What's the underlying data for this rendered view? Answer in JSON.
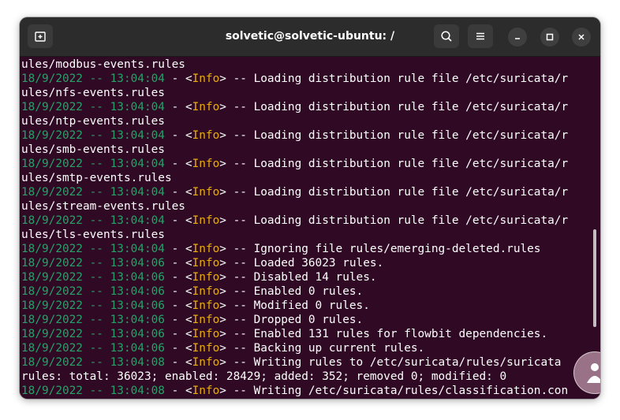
{
  "window": {
    "title": "solvetic@solvetic-ubuntu: /"
  },
  "icons": {
    "new_tab": "new-tab-icon",
    "search": "search-icon",
    "menu": "hamburger-menu-icon",
    "minimize": "minimize-icon",
    "maximize": "maximize-icon",
    "close": "close-icon",
    "watermark": "solvetic-logo"
  },
  "colors": {
    "terminal_bg": "#300a24",
    "titlebar_bg": "#2c2c2c",
    "date_text": "#26a269",
    "info_text": "#e9ad0c",
    "plain_text": "#ffffff"
  },
  "terminal": {
    "lines": [
      {
        "plain": "ules/modbus-events.rules"
      },
      {
        "date": "18/9/2022 -- 13:04:04",
        "pre": " - <",
        "level": "Info",
        "msg": "> -- Loading distribution rule file /etc/suricata/r"
      },
      {
        "plain": "ules/nfs-events.rules"
      },
      {
        "date": "18/9/2022 -- 13:04:04",
        "pre": " - <",
        "level": "Info",
        "msg": "> -- Loading distribution rule file /etc/suricata/r"
      },
      {
        "plain": "ules/ntp-events.rules"
      },
      {
        "date": "18/9/2022 -- 13:04:04",
        "pre": " - <",
        "level": "Info",
        "msg": "> -- Loading distribution rule file /etc/suricata/r"
      },
      {
        "plain": "ules/smb-events.rules"
      },
      {
        "date": "18/9/2022 -- 13:04:04",
        "pre": " - <",
        "level": "Info",
        "msg": "> -- Loading distribution rule file /etc/suricata/r"
      },
      {
        "plain": "ules/smtp-events.rules"
      },
      {
        "date": "18/9/2022 -- 13:04:04",
        "pre": " - <",
        "level": "Info",
        "msg": "> -- Loading distribution rule file /etc/suricata/r"
      },
      {
        "plain": "ules/stream-events.rules"
      },
      {
        "date": "18/9/2022 -- 13:04:04",
        "pre": " - <",
        "level": "Info",
        "msg": "> -- Loading distribution rule file /etc/suricata/r"
      },
      {
        "plain": "ules/tls-events.rules"
      },
      {
        "date": "18/9/2022 -- 13:04:04",
        "pre": " - <",
        "level": "Info",
        "msg": "> -- Ignoring file rules/emerging-deleted.rules"
      },
      {
        "date": "18/9/2022 -- 13:04:06",
        "pre": " - <",
        "level": "Info",
        "msg": "> -- Loaded 36023 rules."
      },
      {
        "date": "18/9/2022 -- 13:04:06",
        "pre": " - <",
        "level": "Info",
        "msg": "> -- Disabled 14 rules."
      },
      {
        "date": "18/9/2022 -- 13:04:06",
        "pre": " - <",
        "level": "Info",
        "msg": "> -- Enabled 0 rules."
      },
      {
        "date": "18/9/2022 -- 13:04:06",
        "pre": " - <",
        "level": "Info",
        "msg": "> -- Modified 0 rules."
      },
      {
        "date": "18/9/2022 -- 13:04:06",
        "pre": " - <",
        "level": "Info",
        "msg": "> -- Dropped 0 rules."
      },
      {
        "date": "18/9/2022 -- 13:04:06",
        "pre": " - <",
        "level": "Info",
        "msg": "> -- Enabled 131 rules for flowbit dependencies."
      },
      {
        "date": "18/9/2022 -- 13:04:06",
        "pre": " - <",
        "level": "Info",
        "msg": "> -- Backing up current rules."
      },
      {
        "date": "18/9/2022 -- 13:04:08",
        "pre": " - <",
        "level": "Info",
        "msg": "> -- Writing rules to /etc/suricata/rules/suricata"
      },
      {
        "plain": "rules: total: 36023; enabled: 28429; added: 352; removed 0; modified: 0"
      },
      {
        "date": "18/9/2022 -- 13:04:08",
        "pre": " - <",
        "level": "Info",
        "msg": "> -- Writing /etc/suricata/rules/classification.con"
      }
    ]
  }
}
